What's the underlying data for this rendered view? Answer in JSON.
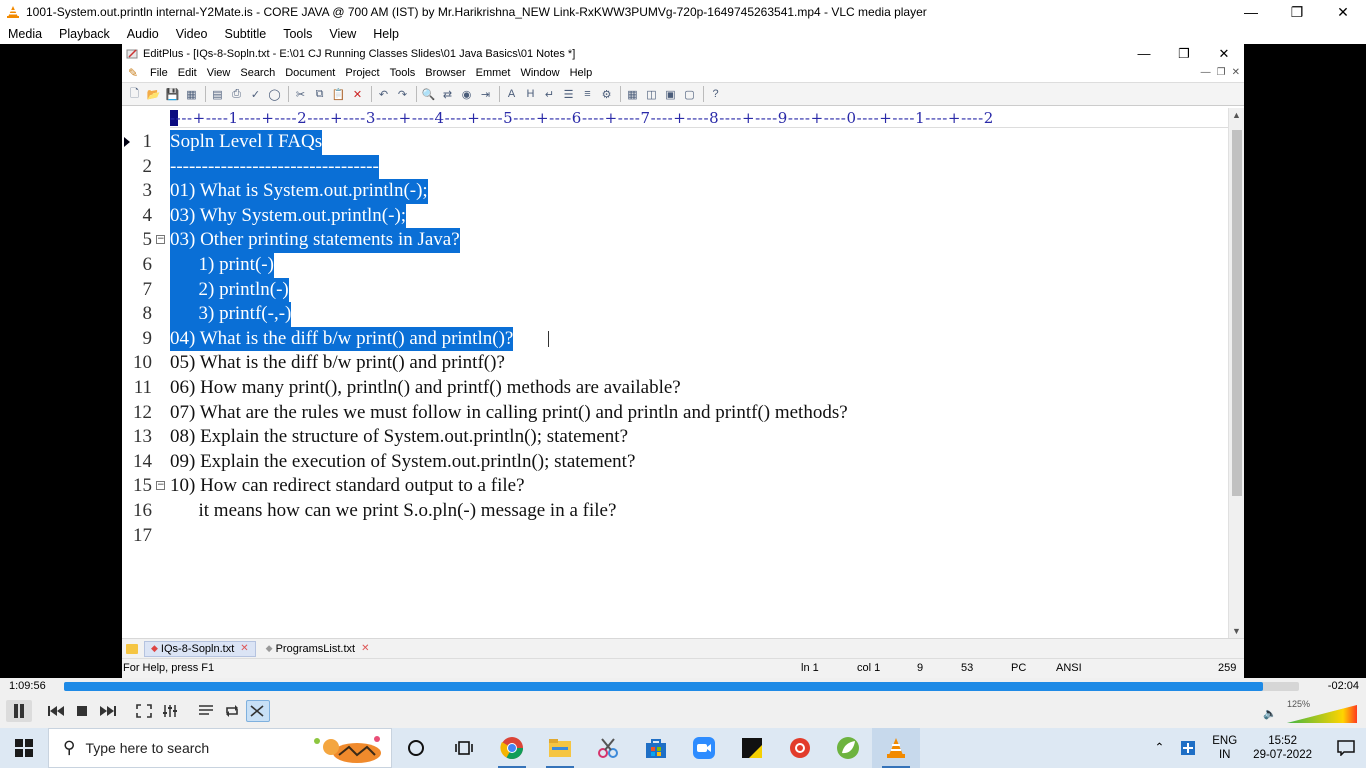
{
  "vlc": {
    "title": "1001-System.out.println internal-Y2Mate.is - CORE JAVA @ 700 AM (IST) by Mr.Harikrishna_NEW Link-RxKWW3PUMVg-720p-1649745263541.mp4 - VLC media player",
    "menu": [
      "Media",
      "Playback",
      "Audio",
      "Video",
      "Subtitle",
      "Tools",
      "View",
      "Help"
    ],
    "time_elapsed": "1:09:56",
    "time_remaining": "-02:04",
    "progress": 0.971,
    "volume_label": "125%",
    "volume": 1.25
  },
  "editplus": {
    "title": "EditPlus - [IQs-8-Sopln.txt - E:\\01 CJ Running Classes Slides\\01 Java Basics\\01 Notes *]",
    "menu": [
      "File",
      "Edit",
      "View",
      "Search",
      "Document",
      "Project",
      "Tools",
      "Browser",
      "Emmet",
      "Window",
      "Help"
    ],
    "ruler": "----+----1----+----2----+----3----+----4----+----5----+----6----+----7----+----8----+----9----+----0----+----1----+----2",
    "lines": [
      {
        "n": "1",
        "text": "Sopln Level I FAQs",
        "selected": true
      },
      {
        "n": "2",
        "text": "---------------------------------",
        "selected": true
      },
      {
        "n": "3",
        "text": "01) What is System.out.println(-);",
        "selected": true
      },
      {
        "n": "4",
        "text": "03) Why System.out.println(-);",
        "selected": true
      },
      {
        "n": "5",
        "text": "03) Other printing statements in Java?",
        "selected": true
      },
      {
        "n": "6",
        "text": "      1) print(-)",
        "selected": true
      },
      {
        "n": "7",
        "text": "      2) println(-)",
        "selected": true
      },
      {
        "n": "8",
        "text": "      3) printf(-,-)",
        "selected": true
      },
      {
        "n": "9",
        "text": "04) What is the diff b/w print() and println()?",
        "selected": true
      },
      {
        "n": "10",
        "text": "05) What is the diff b/w print() and printf()?",
        "selected": false
      },
      {
        "n": "11",
        "text": "06) How many print(), println() and printf() methods are available?",
        "selected": false
      },
      {
        "n": "12",
        "text": "07) What are the rules we must follow in calling print() and println and printf() methods?",
        "selected": false
      },
      {
        "n": "13",
        "text": "08) Explain the structure of System.out.println(); statement?",
        "selected": false
      },
      {
        "n": "14",
        "text": "09) Explain the execution of System.out.println(); statement?",
        "selected": false
      },
      {
        "n": "15",
        "text": "10) How can redirect standard output to a file?",
        "selected": false
      },
      {
        "n": "16",
        "text": "      it means how can we print S.o.pln(-) message in a file?",
        "selected": false
      },
      {
        "n": "17",
        "text": "",
        "selected": false
      }
    ],
    "tabs": [
      {
        "label": "IQs-8-Sopln.txt",
        "active": true
      },
      {
        "label": "ProgramsList.txt",
        "active": false
      }
    ],
    "status": {
      "help": "For Help, press F1",
      "line": "ln 1",
      "col": "col 1",
      "lines_count": "9",
      "chars": "53",
      "mode": "PC",
      "encoding": "ANSI",
      "size": "259"
    },
    "watermark": "zoom"
  },
  "taskbar": {
    "search_placeholder": "Type here to search",
    "lang_top": "ENG",
    "lang_bottom": "IN",
    "time": "15:52",
    "date": "29-07-2022"
  },
  "colors": {
    "selection": "#0a6fd6",
    "seek_fill": "#1e8ae6",
    "vlc_orange": "#f28a00"
  }
}
